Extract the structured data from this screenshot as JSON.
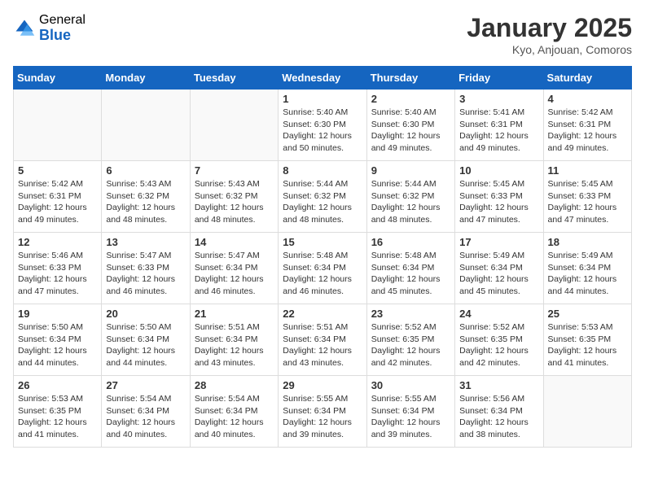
{
  "header": {
    "logo_general": "General",
    "logo_blue": "Blue",
    "month_title": "January 2025",
    "location": "Kyo, Anjouan, Comoros"
  },
  "weekdays": [
    "Sunday",
    "Monday",
    "Tuesday",
    "Wednesday",
    "Thursday",
    "Friday",
    "Saturday"
  ],
  "weeks": [
    [
      {
        "day": "",
        "info": ""
      },
      {
        "day": "",
        "info": ""
      },
      {
        "day": "",
        "info": ""
      },
      {
        "day": "1",
        "info": "Sunrise: 5:40 AM\nSunset: 6:30 PM\nDaylight: 12 hours\nand 50 minutes."
      },
      {
        "day": "2",
        "info": "Sunrise: 5:40 AM\nSunset: 6:30 PM\nDaylight: 12 hours\nand 49 minutes."
      },
      {
        "day": "3",
        "info": "Sunrise: 5:41 AM\nSunset: 6:31 PM\nDaylight: 12 hours\nand 49 minutes."
      },
      {
        "day": "4",
        "info": "Sunrise: 5:42 AM\nSunset: 6:31 PM\nDaylight: 12 hours\nand 49 minutes."
      }
    ],
    [
      {
        "day": "5",
        "info": "Sunrise: 5:42 AM\nSunset: 6:31 PM\nDaylight: 12 hours\nand 49 minutes."
      },
      {
        "day": "6",
        "info": "Sunrise: 5:43 AM\nSunset: 6:32 PM\nDaylight: 12 hours\nand 48 minutes."
      },
      {
        "day": "7",
        "info": "Sunrise: 5:43 AM\nSunset: 6:32 PM\nDaylight: 12 hours\nand 48 minutes."
      },
      {
        "day": "8",
        "info": "Sunrise: 5:44 AM\nSunset: 6:32 PM\nDaylight: 12 hours\nand 48 minutes."
      },
      {
        "day": "9",
        "info": "Sunrise: 5:44 AM\nSunset: 6:32 PM\nDaylight: 12 hours\nand 48 minutes."
      },
      {
        "day": "10",
        "info": "Sunrise: 5:45 AM\nSunset: 6:33 PM\nDaylight: 12 hours\nand 47 minutes."
      },
      {
        "day": "11",
        "info": "Sunrise: 5:45 AM\nSunset: 6:33 PM\nDaylight: 12 hours\nand 47 minutes."
      }
    ],
    [
      {
        "day": "12",
        "info": "Sunrise: 5:46 AM\nSunset: 6:33 PM\nDaylight: 12 hours\nand 47 minutes."
      },
      {
        "day": "13",
        "info": "Sunrise: 5:47 AM\nSunset: 6:33 PM\nDaylight: 12 hours\nand 46 minutes."
      },
      {
        "day": "14",
        "info": "Sunrise: 5:47 AM\nSunset: 6:34 PM\nDaylight: 12 hours\nand 46 minutes."
      },
      {
        "day": "15",
        "info": "Sunrise: 5:48 AM\nSunset: 6:34 PM\nDaylight: 12 hours\nand 46 minutes."
      },
      {
        "day": "16",
        "info": "Sunrise: 5:48 AM\nSunset: 6:34 PM\nDaylight: 12 hours\nand 45 minutes."
      },
      {
        "day": "17",
        "info": "Sunrise: 5:49 AM\nSunset: 6:34 PM\nDaylight: 12 hours\nand 45 minutes."
      },
      {
        "day": "18",
        "info": "Sunrise: 5:49 AM\nSunset: 6:34 PM\nDaylight: 12 hours\nand 44 minutes."
      }
    ],
    [
      {
        "day": "19",
        "info": "Sunrise: 5:50 AM\nSunset: 6:34 PM\nDaylight: 12 hours\nand 44 minutes."
      },
      {
        "day": "20",
        "info": "Sunrise: 5:50 AM\nSunset: 6:34 PM\nDaylight: 12 hours\nand 44 minutes."
      },
      {
        "day": "21",
        "info": "Sunrise: 5:51 AM\nSunset: 6:34 PM\nDaylight: 12 hours\nand 43 minutes."
      },
      {
        "day": "22",
        "info": "Sunrise: 5:51 AM\nSunset: 6:34 PM\nDaylight: 12 hours\nand 43 minutes."
      },
      {
        "day": "23",
        "info": "Sunrise: 5:52 AM\nSunset: 6:35 PM\nDaylight: 12 hours\nand 42 minutes."
      },
      {
        "day": "24",
        "info": "Sunrise: 5:52 AM\nSunset: 6:35 PM\nDaylight: 12 hours\nand 42 minutes."
      },
      {
        "day": "25",
        "info": "Sunrise: 5:53 AM\nSunset: 6:35 PM\nDaylight: 12 hours\nand 41 minutes."
      }
    ],
    [
      {
        "day": "26",
        "info": "Sunrise: 5:53 AM\nSunset: 6:35 PM\nDaylight: 12 hours\nand 41 minutes."
      },
      {
        "day": "27",
        "info": "Sunrise: 5:54 AM\nSunset: 6:34 PM\nDaylight: 12 hours\nand 40 minutes."
      },
      {
        "day": "28",
        "info": "Sunrise: 5:54 AM\nSunset: 6:34 PM\nDaylight: 12 hours\nand 40 minutes."
      },
      {
        "day": "29",
        "info": "Sunrise: 5:55 AM\nSunset: 6:34 PM\nDaylight: 12 hours\nand 39 minutes."
      },
      {
        "day": "30",
        "info": "Sunrise: 5:55 AM\nSunset: 6:34 PM\nDaylight: 12 hours\nand 39 minutes."
      },
      {
        "day": "31",
        "info": "Sunrise: 5:56 AM\nSunset: 6:34 PM\nDaylight: 12 hours\nand 38 minutes."
      },
      {
        "day": "",
        "info": ""
      }
    ]
  ]
}
